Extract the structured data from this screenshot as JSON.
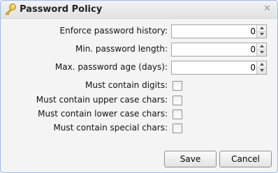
{
  "dialog": {
    "title": "Password Policy",
    "title_icon": "key-icon",
    "close_icon": "close-icon",
    "close_glyph": "✕"
  },
  "fields": {
    "history": {
      "label": "Enforce password history:",
      "value": "0"
    },
    "min_length": {
      "label": "Min. password length:",
      "value": "0"
    },
    "max_age": {
      "label": "Max. password age (days):",
      "value": "0"
    }
  },
  "checks": {
    "digits": {
      "label": "Must contain digits:",
      "checked": false
    },
    "upper": {
      "label": "Must contain upper case chars:",
      "checked": false
    },
    "lower": {
      "label": "Must contain lower case chars:",
      "checked": false
    },
    "special": {
      "label": "Must contain special chars:",
      "checked": false
    }
  },
  "buttons": {
    "save": "Save",
    "cancel": "Cancel"
  },
  "colors": {
    "border": "#99bbe8",
    "background": "#f4f4f4",
    "key_icon": "#e2b53a"
  }
}
